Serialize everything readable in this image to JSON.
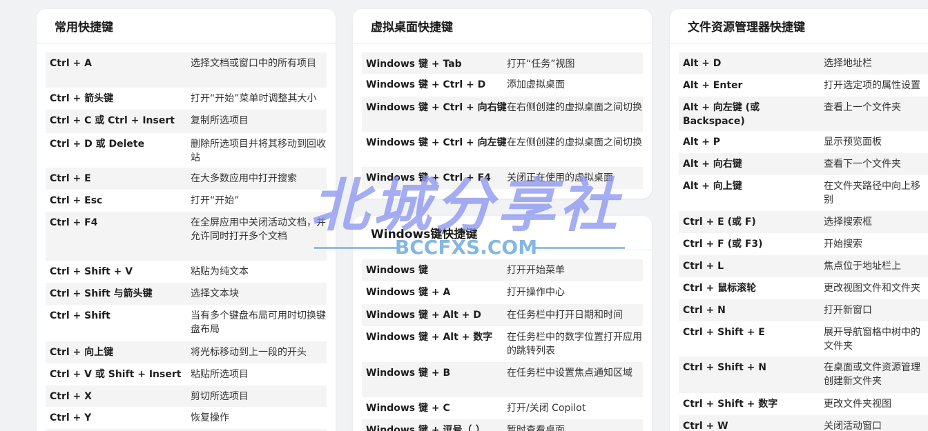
{
  "cards": {
    "common": {
      "title": "常用快捷键",
      "rows": [
        {
          "key": "Ctrl + A",
          "desc": "选择文档或窗口中的所有项目"
        },
        {
          "key": "Ctrl + 箭头键",
          "desc": "打开“开始”菜单时调整其大小"
        },
        {
          "key": "Ctrl + C 或 Ctrl + Insert",
          "desc": "复制所选项目"
        },
        {
          "key": "Ctrl + D 或 Delete",
          "desc": "删除所选项目并将其移动到回收站"
        },
        {
          "key": "Ctrl + E",
          "desc": "在大多数应用中打开搜索"
        },
        {
          "key": "Ctrl + Esc",
          "desc": "打开“开始”"
        },
        {
          "key": "Ctrl + F4",
          "desc": "在全屏应用中关闭活动文档，并允许同时打开多个文档"
        },
        {
          "key": "Ctrl + Shift + V",
          "desc": "粘贴为纯文本"
        },
        {
          "key": "Ctrl + Shift 与箭头键",
          "desc": "选择文本块"
        },
        {
          "key": "Ctrl + Shift",
          "desc": "当有多个键盘布局可用时切换键盘布局"
        },
        {
          "key": "Ctrl + 向上键",
          "desc": "将光标移动到上一段的开头"
        },
        {
          "key": "Ctrl + V 或 Shift + Insert",
          "desc": "粘贴所选项目"
        },
        {
          "key": "Ctrl + X",
          "desc": "剪切所选项目"
        },
        {
          "key": "Ctrl + Y",
          "desc": "恢复操作"
        }
      ]
    },
    "virtual": {
      "title": "虚拟桌面快捷键",
      "rows": [
        {
          "key": "Windows 键 + Tab",
          "desc": "打开“任务”视图"
        },
        {
          "key": "Windows 键 + Ctrl + D",
          "desc": "添加虚拟桌面"
        },
        {
          "key": "Windows 键 + Ctrl + 向右键",
          "desc": "在右侧创建的虚拟桌面之间切换"
        },
        {
          "key": "Windows 键 + Ctrl + 向左键",
          "desc": "在左侧创建的虚拟桌面之间切换"
        },
        {
          "key": "Windows 键 + Ctrl + F4",
          "desc": "关闭正在使用的虚拟桌面"
        }
      ]
    },
    "windows": {
      "title": "Windows键快捷键",
      "rows": [
        {
          "key": "Windows 键",
          "desc": "打开开始菜单"
        },
        {
          "key": "Windows 键 + A",
          "desc": "打开操作中心"
        },
        {
          "key": "Windows 键 + Alt + D",
          "desc": "在任务栏中打开日期和时间"
        },
        {
          "key": "Windows 键 + Alt + 数字",
          "desc": "在任务栏中的数字位置打开应用的跳转列表"
        },
        {
          "key": "Windows 键 + B",
          "desc": "在任务栏中设置焦点通知区域"
        },
        {
          "key": "Windows 键 + C",
          "desc": "打开/关闭 Copilot"
        },
        {
          "key": "Windows 键 + 逗号（,）",
          "desc": "暂时查看桌面"
        }
      ]
    },
    "explorer": {
      "title": "文件资源管理器快捷键",
      "rows": [
        {
          "key": "Alt + D",
          "desc": "选择地址栏"
        },
        {
          "key": "Alt + Enter",
          "desc": "打开选定项的属性设置"
        },
        {
          "key": "Alt + 向左键 (或 Backspace)",
          "desc": "查看上一个文件夹"
        },
        {
          "key": "Alt + P",
          "desc": "显示预览面板"
        },
        {
          "key": "Alt + 向右键",
          "desc": "查看下一个文件夹"
        },
        {
          "key": "Alt + 向上键",
          "desc": "在文件夹路径中向上移"
        },
        {
          "key": "Ctrl + E (或 F)",
          "desc": "选择搜索框"
        },
        {
          "key": "Ctrl + F (或 F3)",
          "desc": "开始搜索"
        },
        {
          "key": "Ctrl + L",
          "desc": "焦点位于地址栏上"
        },
        {
          "key": "Ctrl + 鼠标滚轮",
          "desc": "更改视图文件和文件夹"
        },
        {
          "key": "Ctrl + N",
          "desc": "打开新窗口"
        },
        {
          "key": "Ctrl + Shift + E",
          "desc": "展开导航窗格中树中的"
        },
        {
          "key": "Ctrl + Shift + N",
          "desc": "在桌面或文件资源管理"
        },
        {
          "key": "Ctrl + Shift + 数字",
          "desc": "更改文件夹视图"
        },
        {
          "key": "Ctrl + W",
          "desc": "关闭活动窗口"
        }
      ],
      "continuations": {
        "r5": "别",
        "r11": "文件夹",
        "r12": "创建新文件夹"
      }
    }
  },
  "watermark": {
    "main": "北城分享社",
    "sub": "BCCFXS.COM"
  }
}
